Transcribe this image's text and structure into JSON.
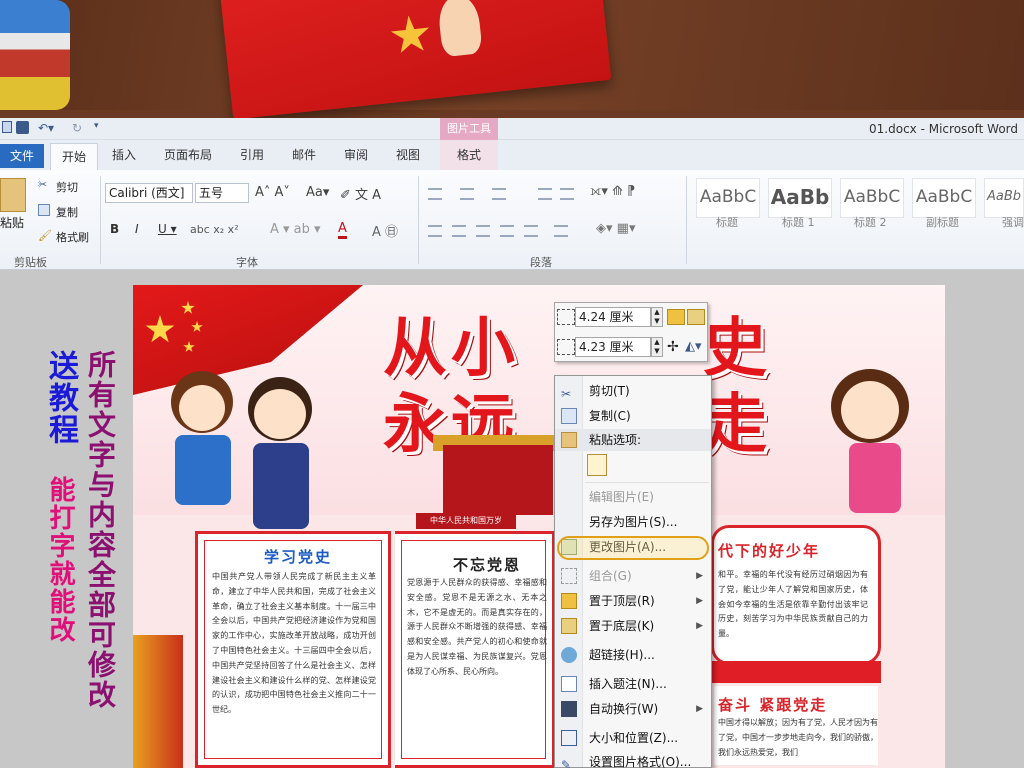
{
  "ribbon": {
    "doc_title": "01.docx - Microsoft Word",
    "picture_tools": "图片工具",
    "tabs": [
      "文件",
      "开始",
      "插入",
      "页面布局",
      "引用",
      "邮件",
      "审阅",
      "视图",
      "格式"
    ],
    "clipboard": {
      "paste": "粘贴",
      "cut": "剪切",
      "copy": "复制",
      "format_painter": "格式刷",
      "group_label": "剪贴板"
    },
    "font": {
      "name": "Calibri (西文]",
      "size": "五号",
      "group_label": "字体"
    },
    "paragraph": {
      "group_label": "段落"
    },
    "styles": [
      {
        "preview": "AaBbC",
        "label": "标题"
      },
      {
        "preview": "AaBb",
        "label": "标题 1"
      },
      {
        "preview": "AaBbC",
        "label": "标题 2"
      },
      {
        "preview": "AaBbC",
        "label": "副标题"
      },
      {
        "preview": "AaBb",
        "label": "强调"
      }
    ],
    "colors": {
      "file_tab": "#2a6bc2",
      "picture_tools": "#e6a9c5"
    }
  },
  "size_toolbar": {
    "height": "4.24 厘米",
    "width": "4.23 厘米"
  },
  "context_menu": {
    "items": [
      {
        "label": "剪切(T)",
        "icon": "scissors-icon",
        "enabled": true
      },
      {
        "label": "复制(C)",
        "icon": "copy-icon",
        "enabled": true
      },
      {
        "label": "粘贴选项:",
        "icon": "paste-icon",
        "enabled": true
      },
      {
        "label": "编辑图片(E)",
        "icon": "",
        "enabled": false
      },
      {
        "label": "另存为图片(S)...",
        "icon": "",
        "enabled": true
      },
      {
        "label": "更改图片(A)...",
        "icon": "change-picture-icon",
        "enabled": true
      },
      {
        "label": "组合(G)",
        "icon": "group-icon",
        "enabled": false
      },
      {
        "label": "置于顶层(R)",
        "icon": "bring-front-icon",
        "enabled": true
      },
      {
        "label": "置于底层(K)",
        "icon": "send-back-icon",
        "enabled": true
      },
      {
        "label": "超链接(H)...",
        "icon": "hyperlink-icon",
        "enabled": true
      },
      {
        "label": "插入题注(N)...",
        "icon": "caption-icon",
        "enabled": true
      },
      {
        "label": "自动换行(W)",
        "icon": "wrap-icon",
        "enabled": true
      },
      {
        "label": "大小和位置(Z)...",
        "icon": "size-icon",
        "enabled": true
      },
      {
        "label": "设置图片格式(O)...",
        "icon": "format-icon",
        "enabled": true
      }
    ]
  },
  "promo": {
    "line1": "送教程",
    "line2": "能打字就能改",
    "line3": "所有文字与内容全部可修改"
  },
  "poster": {
    "title_line1": "从小",
    "title_line1_b": "史",
    "title_line2": "永远",
    "title_line2_b": "走",
    "gate_sign": "中华人民共和国万岁",
    "panel1": {
      "title": "学习党史",
      "body": "中国共产党人带领人民完成了新民主主义革命，建立了中华人民共和国，完成了社会主义革命，确立了社会主义基本制度。十一届三中全会以后，中国共产党把经济建设作为党和国家的工作中心，实施改革开放战略，成功开创了中国特色社会主义。十三届四中全会以后，中国共产党坚持回答了什么是社会主义、怎样建设社会主义和建设什么样的党、怎样建设党的认识，成功把中国特色社会主义推向二十一世纪。"
    },
    "panel2": {
      "title": "不忘党恩",
      "body": "党恩源于人民群众的获得感、幸福感和安全感。党恩不是无源之水、无本之木，它不是虚无的。而是真实存在的，源于人民群众不断增强的获得感、幸福感和安全感。共产党人的初心和使命就是为人民谋幸福、为民族谋复兴。党恩体现了心所系、民心所向。"
    },
    "panel3": {
      "title": "代下的好少年",
      "body": "和平。幸福的年代没有经历过硝烟因为有了党，能让少年人了解党和国家历史，体会如今幸福的生活是依靠辛勤付出该牢记历史，刻苦学习为中华民族贡献自己的力量。"
    },
    "panel4": {
      "title": "奋斗 紧跟党走",
      "body": "中国才得以解放；因为有了党，人民才因为有了党，中国才一步步地走向今，我们的骄傲，我们永远热爱党，我们"
    }
  }
}
